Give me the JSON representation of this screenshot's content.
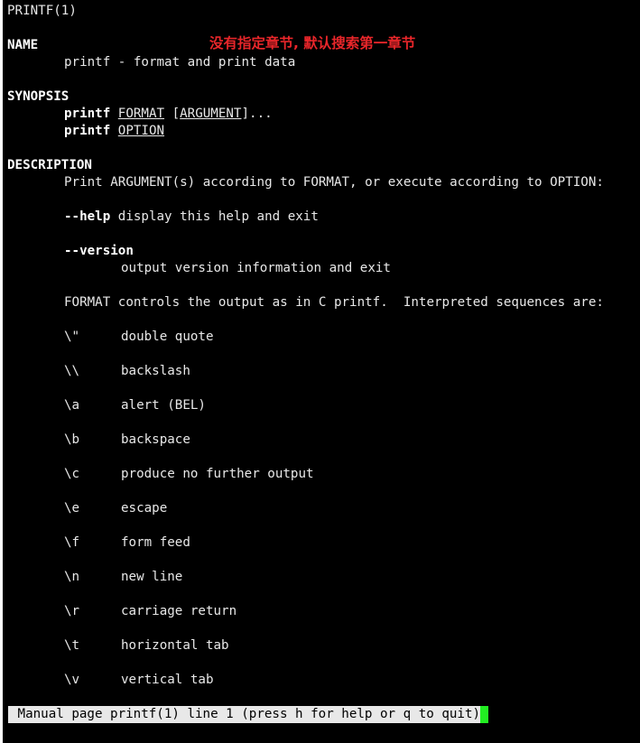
{
  "header": {
    "title": "PRINTF(1)"
  },
  "annotation": "没有指定章节, 默认搜索第一章节",
  "name_section": {
    "heading": "NAME",
    "text": "printf - format and print data"
  },
  "synopsis": {
    "heading": "SYNOPSIS",
    "line1": {
      "cmd": "printf",
      "arg1": "FORMAT",
      "arg2_open": "[",
      "arg2": "ARGUMENT",
      "arg2_close": "]..."
    },
    "line2": {
      "cmd": "printf",
      "arg1": "OPTION"
    }
  },
  "description": {
    "heading": "DESCRIPTION",
    "intro": "Print ARGUMENT(s) according to FORMAT, or execute according to OPTION:",
    "help_flag": "--help",
    "help_text": "display this help and exit",
    "version_flag": "--version",
    "version_text": "output version information and exit",
    "format_text": "FORMAT controls the output as in C printf.  Interpreted sequences are:",
    "escapes": [
      {
        "seq": "\\\"",
        "desc": "double quote"
      },
      {
        "seq": "\\\\",
        "desc": "backslash"
      },
      {
        "seq": "\\a",
        "desc": "alert (BEL)"
      },
      {
        "seq": "\\b",
        "desc": "backspace"
      },
      {
        "seq": "\\c",
        "desc": "produce no further output"
      },
      {
        "seq": "\\e",
        "desc": "escape"
      },
      {
        "seq": "\\f",
        "desc": "form feed"
      },
      {
        "seq": "\\n",
        "desc": "new line"
      },
      {
        "seq": "\\r",
        "desc": "carriage return"
      },
      {
        "seq": "\\t",
        "desc": "horizontal tab"
      },
      {
        "seq": "\\v",
        "desc": "vertical tab"
      }
    ]
  },
  "status_bar": {
    "text": " Manual page printf(1) line 1 (press h for help or q to quit)"
  },
  "colors": {
    "background": "#000000",
    "text": "#e8e8e8",
    "annotation": "#e8262a",
    "cursor": "#22ee22",
    "status_bg": "#e8e8e8"
  }
}
